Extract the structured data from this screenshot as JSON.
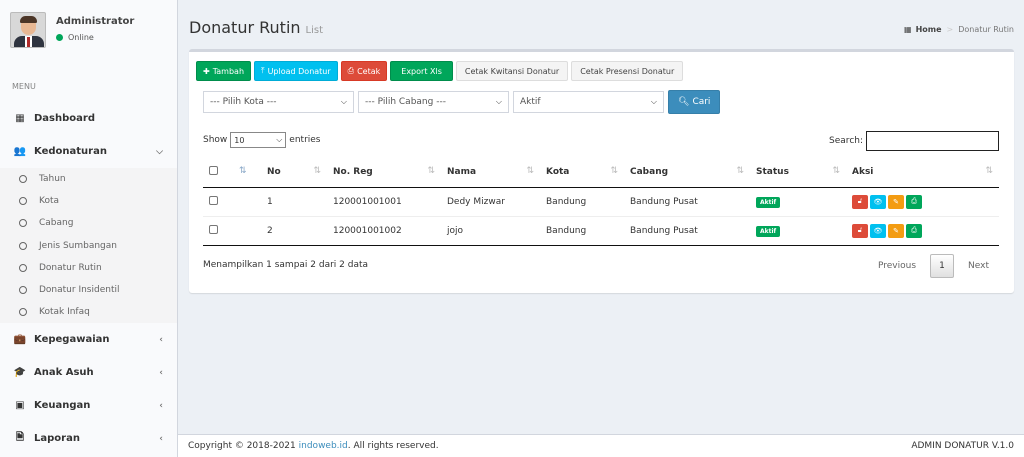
{
  "user": {
    "name": "Administrator",
    "status": "Online"
  },
  "sidebar": {
    "menu_header": "MENU",
    "dashboard": "Dashboard",
    "kedonaturan": "Kedonaturan",
    "submenu": [
      "Tahun",
      "Kota",
      "Cabang",
      "Jenis Sumbangan",
      "Donatur Rutin",
      "Donatur Insidentil",
      "Kotak Infaq"
    ],
    "kepegawaian": "Kepegawaian",
    "anak_asuh": "Anak Asuh",
    "keuangan": "Keuangan",
    "laporan": "Laporan"
  },
  "header": {
    "title": "Donatur Rutin",
    "subtitle": "List"
  },
  "breadcrumb": {
    "home": "Home",
    "current": "Donatur Rutin"
  },
  "toolbar": {
    "tambah": "Tambah",
    "upload": "Upload Donatur",
    "cetak": "Cetak",
    "export": "Export Xls",
    "kwitansi": "Cetak Kwitansi Donatur",
    "presensi": "Cetak Presensi Donatur"
  },
  "filters": {
    "kota": "--- Pilih Kota ---",
    "cabang": "--- Pilih Cabang ---",
    "status": "Aktif",
    "cari": "Cari"
  },
  "table_controls": {
    "show": "Show",
    "entries_value": "10",
    "entries": "entries",
    "search": "Search:"
  },
  "table": {
    "headers": {
      "no": "No",
      "noreg": "No. Reg",
      "nama": "Nama",
      "kota": "Kota",
      "cabang": "Cabang",
      "status": "Status",
      "aksi": "Aksi"
    },
    "rows": [
      {
        "no": "1",
        "noreg": "120001001001",
        "nama": "Dedy Mizwar",
        "kota": "Bandung",
        "cabang": "Bandung Pusat",
        "status": "Aktif"
      },
      {
        "no": "2",
        "noreg": "120001001002",
        "nama": "jojo",
        "kota": "Bandung",
        "cabang": "Bandung Pusat",
        "status": "Aktif"
      }
    ]
  },
  "info": "Menampilkan 1 sampai 2 dari 2 data",
  "pagination": {
    "previous": "Previous",
    "current": "1",
    "next": "Next"
  },
  "footer": {
    "copyright": "Copyright © 2018-2021",
    "link": "indoweb.id",
    "rights": ". All rights reserved.",
    "version": "ADMIN DONATUR V.1.0"
  },
  "colors": {
    "green": "#00a65a",
    "blue": "#00c0ef",
    "red": "#dd4b39",
    "orange": "#f39c12",
    "primary": "#3c8dbc"
  }
}
